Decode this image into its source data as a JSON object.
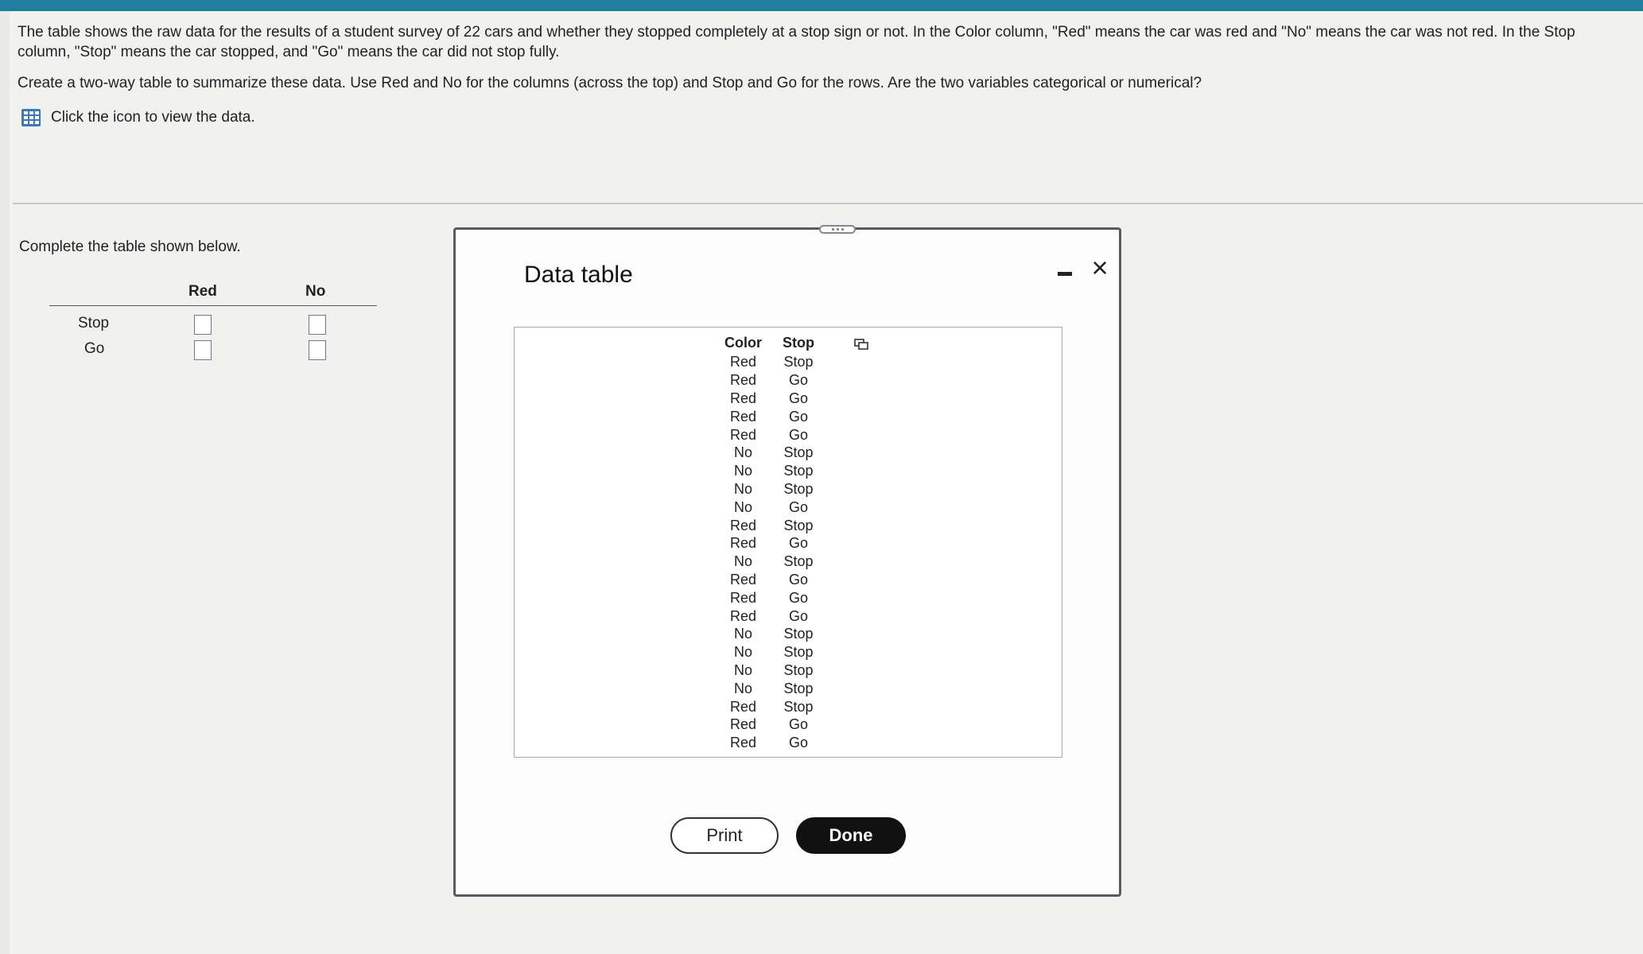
{
  "question": {
    "paragraph1": "The table shows the raw data for the results of a student survey of 22 cars and whether they stopped completely at a stop sign or not. In the Color column, \"Red\" means the car was red and \"No\" means the car was not red. In the Stop column, \"Stop\" means the car stopped, and \"Go\" means the car did not stop fully.",
    "paragraph2": "Create a two-way table to summarize these data. Use Red and No for the columns (across the top) and Stop and Go for the rows. Are the two variables categorical or numerical?",
    "data_link": "Click the icon to view the data."
  },
  "answer_area": {
    "instruction": "Complete the table shown below.",
    "col_headers": [
      "Red",
      "No"
    ],
    "row_labels": [
      "Stop",
      "Go"
    ],
    "cells": [
      [
        "",
        ""
      ],
      [
        "",
        ""
      ]
    ]
  },
  "modal": {
    "title": "Data table",
    "columns": [
      "Color",
      "Stop"
    ],
    "rows": [
      [
        "Red",
        "Stop"
      ],
      [
        "Red",
        "Go"
      ],
      [
        "Red",
        "Go"
      ],
      [
        "Red",
        "Go"
      ],
      [
        "Red",
        "Go"
      ],
      [
        "No",
        "Stop"
      ],
      [
        "No",
        "Stop"
      ],
      [
        "No",
        "Stop"
      ],
      [
        "No",
        "Go"
      ],
      [
        "Red",
        "Stop"
      ],
      [
        "Red",
        "Go"
      ],
      [
        "No",
        "Stop"
      ],
      [
        "Red",
        "Go"
      ],
      [
        "Red",
        "Go"
      ],
      [
        "Red",
        "Go"
      ],
      [
        "No",
        "Stop"
      ],
      [
        "No",
        "Stop"
      ],
      [
        "No",
        "Stop"
      ],
      [
        "No",
        "Stop"
      ],
      [
        "Red",
        "Stop"
      ],
      [
        "Red",
        "Go"
      ],
      [
        "Red",
        "Go"
      ]
    ],
    "print_label": "Print",
    "done_label": "Done",
    "close_glyph": "×"
  },
  "colors": {
    "top_bar": "#1f7f9f",
    "grid_icon": "#3b78c2",
    "done_bg": "#111111"
  }
}
